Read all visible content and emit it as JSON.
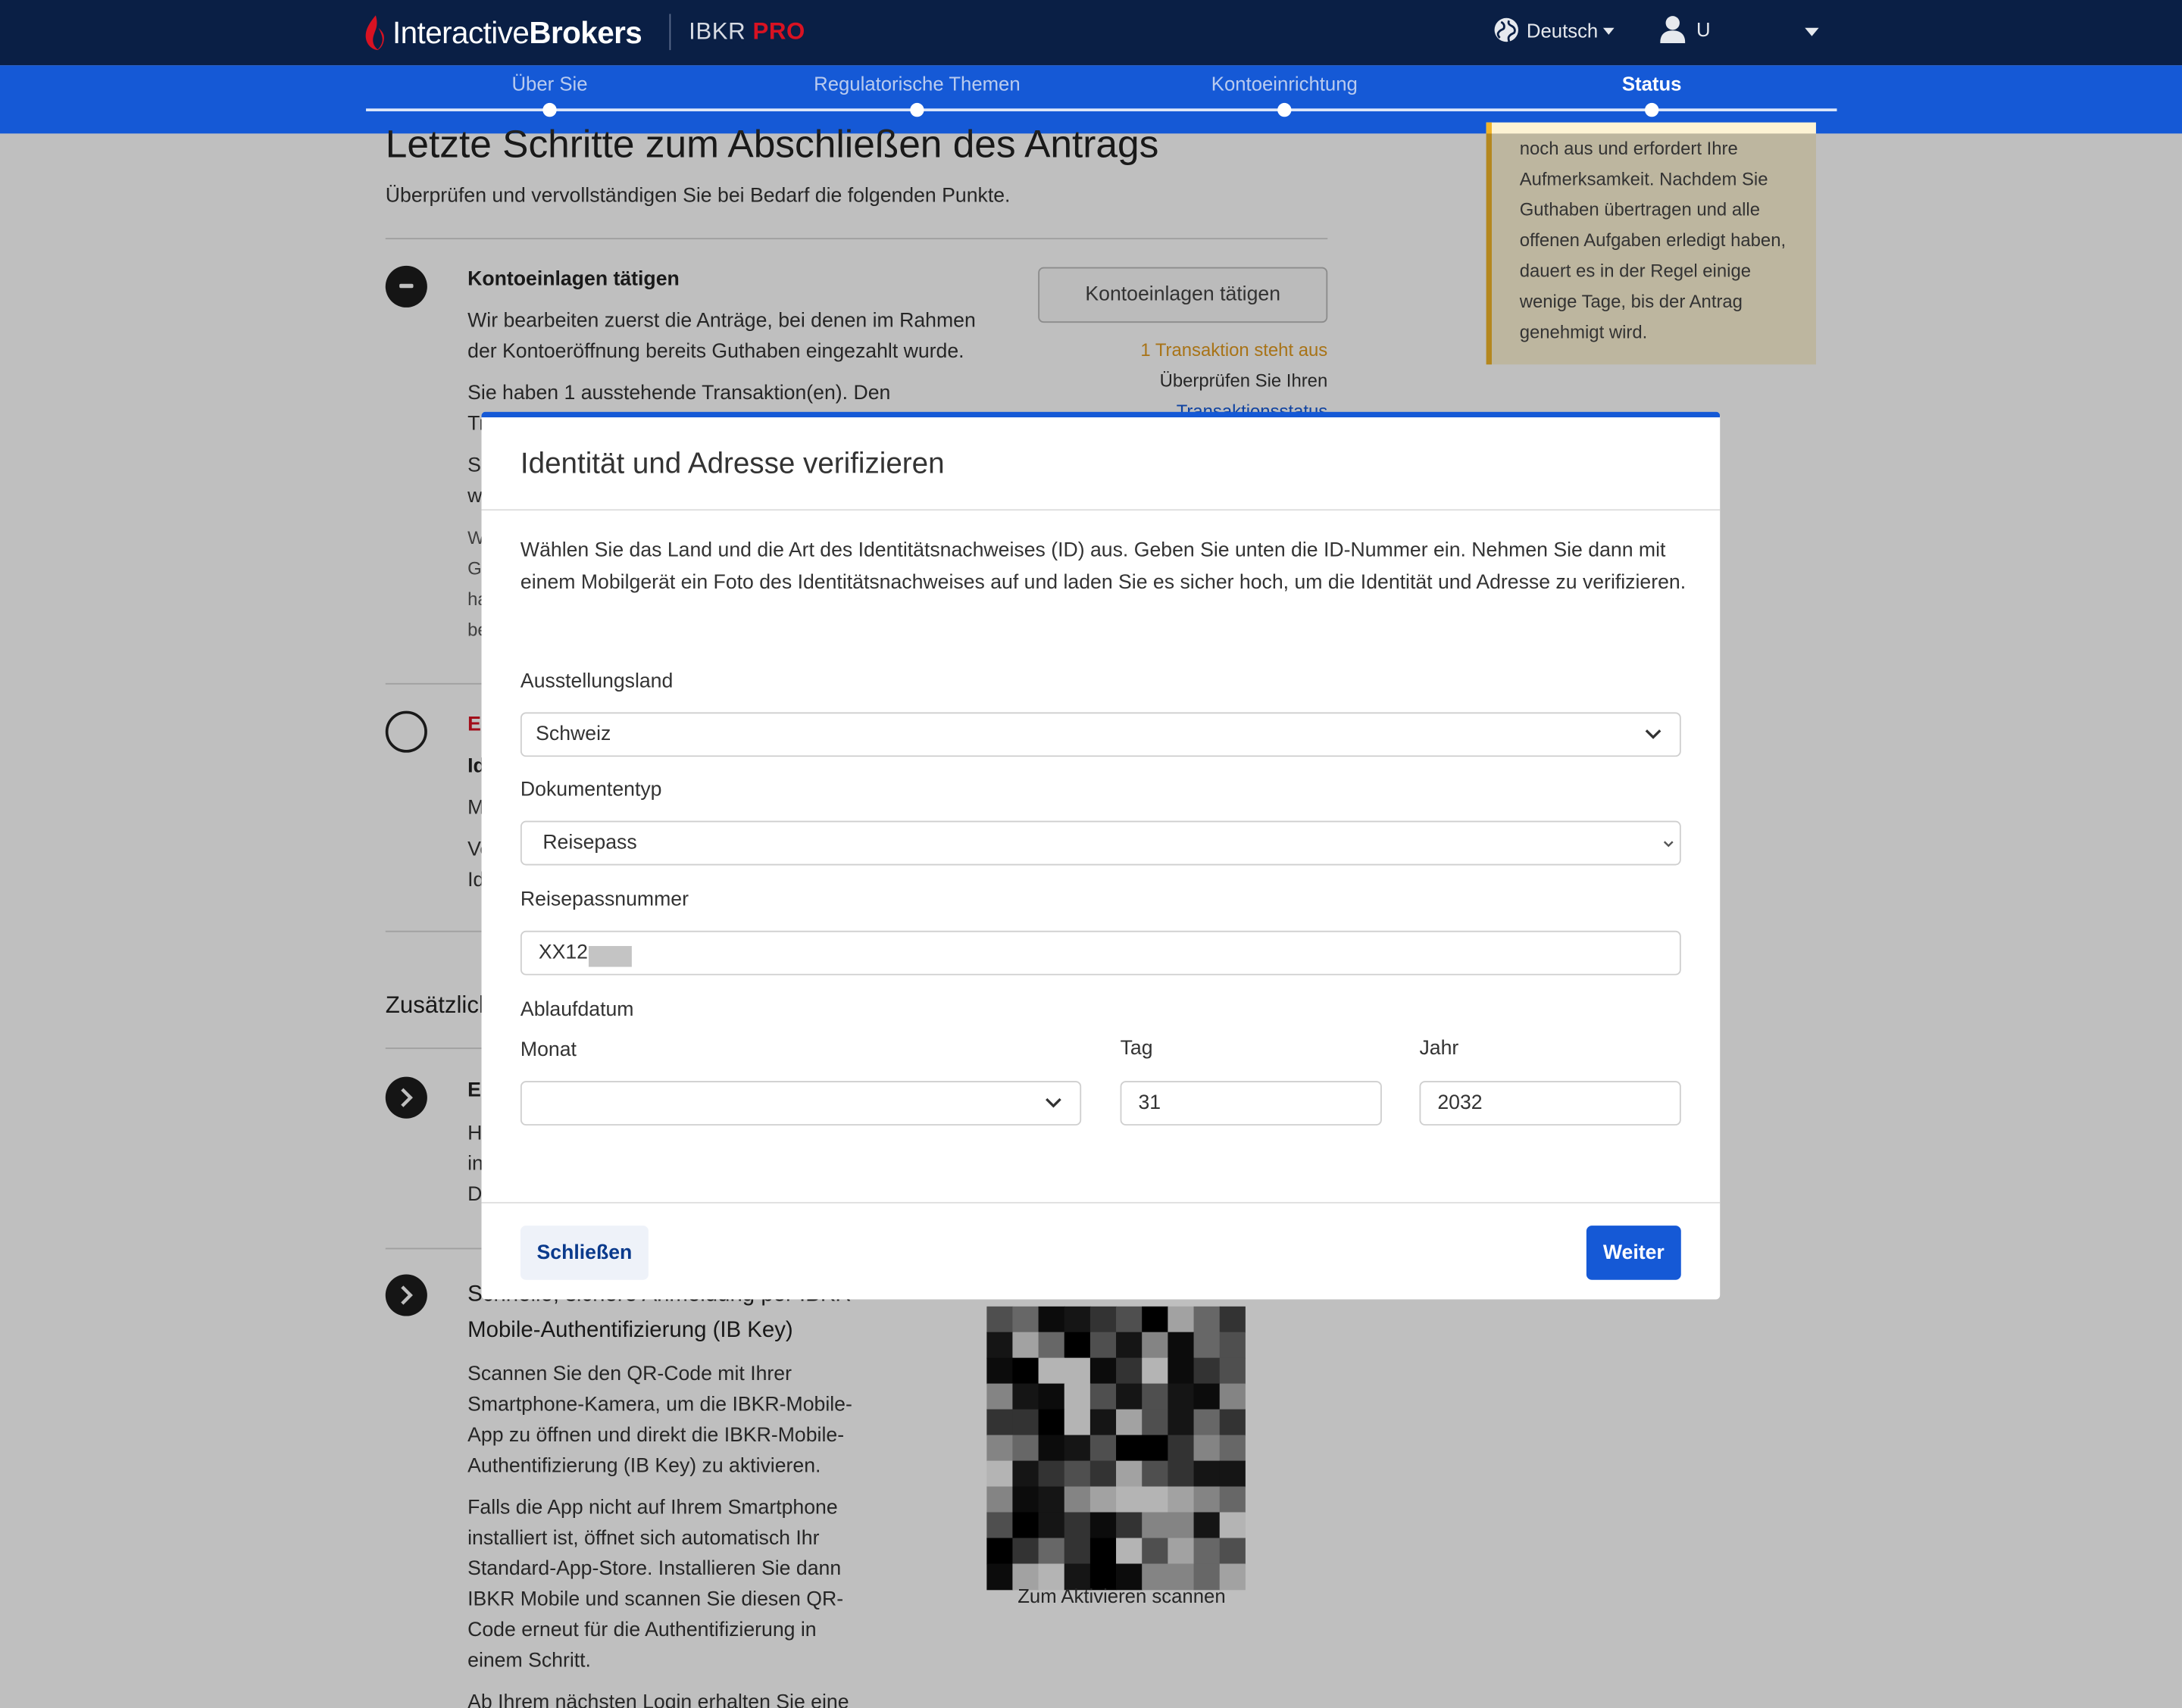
{
  "header": {
    "logo_regular": "Interactive",
    "logo_bold": "Brokers",
    "product": "IBKR",
    "product_pro": "PRO",
    "language": "Deutsch",
    "user": "U"
  },
  "steps": [
    {
      "label": "Über Sie"
    },
    {
      "label": "Regulatorische Themen"
    },
    {
      "label": "Kontoeinrichtung"
    },
    {
      "label": "Status"
    }
  ],
  "page": {
    "title": "Letzte Schritte zum Abschließen des Antrags",
    "subtitle": "Überprüfen und vervollständigen Sie bei Bedarf die folgenden Punkte.",
    "deposit": {
      "title": "Kontoeinlagen tätigen",
      "line1": "Wir bearbeiten zuerst die Anträge, bei denen im Rahmen",
      "line2": "der Kontoeröffnung bereits Guthaben eingezahlt wurde.",
      "line3": "Sie haben 1 ausstehende Transaktion(en). Den",
      "line4": "Tr",
      "line5": "Se",
      "line6": "w",
      "small1": "W",
      "small2": "G",
      "small3": "ha",
      "small4": "be",
      "button": "Kontoeinlagen tätigen",
      "pending": "1 Transaktion steht aus",
      "review": "Überprüfen Sie Ihren",
      "status_link": "Transaktionsstatus"
    },
    "notice_lines": [
      "noch aus und erfordert Ihre",
      "Aufmerksamkeit. Nachdem Sie",
      "Guthaben übertragen und alle",
      "offenen Aufgaben erledigt haben,",
      "dauert es in der Regel einige",
      "wenige Tage, bis der Antrag",
      "genehmigt wird."
    ],
    "identity": {
      "red": "El",
      "bold": "Id",
      "line1": "M",
      "line2": "Ve",
      "line3": "Id"
    },
    "additional_heading": "Zusätzlich",
    "item3": {
      "bold": "Er",
      "line1": "H",
      "line2": "in",
      "line3": "D"
    },
    "ibkey": {
      "title1": "Schnelle, sichere Anmeldung per IBKR",
      "title2": "Mobile-Authentifizierung (IB Key)",
      "p1_lines": [
        "Scannen Sie den QR-Code mit Ihrer",
        "Smartphone-Kamera, um die IBKR-Mobile-",
        "App zu öffnen und direkt die IBKR-Mobile-",
        "Authentifizierung (IB Key) zu aktivieren."
      ],
      "p2_lines": [
        "Falls die App nicht auf Ihrem Smartphone",
        "installiert ist, öffnet sich automatisch Ihr",
        "Standard-App-Store. Installieren Sie dann",
        "IBKR Mobile und scannen Sie diesen QR-",
        "Code erneut für die Authentifizierung in",
        "einem Schritt."
      ],
      "p3": "Ab Ihrem nächsten Login erhalten Sie eine",
      "qr_caption": "Zum Aktivieren scannen"
    }
  },
  "modal": {
    "title": "Identität und Adresse verifizieren",
    "description": "Wählen Sie das Land und die Art des Identitätsnachweises (ID) aus. Geben Sie unten die ID-Nummer ein. Nehmen Sie dann mit einem Mobilgerät ein Foto des Identitätsnachweises auf und laden Sie es sicher hoch, um die Identität und Adresse zu verifizieren.",
    "country_label": "Ausstellungsland",
    "country_value": "Schweiz",
    "doctype_label": "Dokumententyp",
    "doctype_value": "Reisepass",
    "passport_label": "Reisepassnummer",
    "passport_value": "XX12",
    "expiry_label": "Ablaufdatum",
    "month_label": "Monat",
    "month_value": "",
    "day_label": "Tag",
    "day_value": "31",
    "year_label": "Jahr",
    "year_value": "2032",
    "close_button": "Schließen",
    "next_button": "Weiter"
  },
  "colors": {
    "header_bg": "#0a1f45",
    "steps_bg": "#1559d6",
    "accent": "#1559d6",
    "brand_red": "#d81222",
    "pending_orange": "#e19a1f",
    "notice_bg": "#fdf3d4"
  }
}
